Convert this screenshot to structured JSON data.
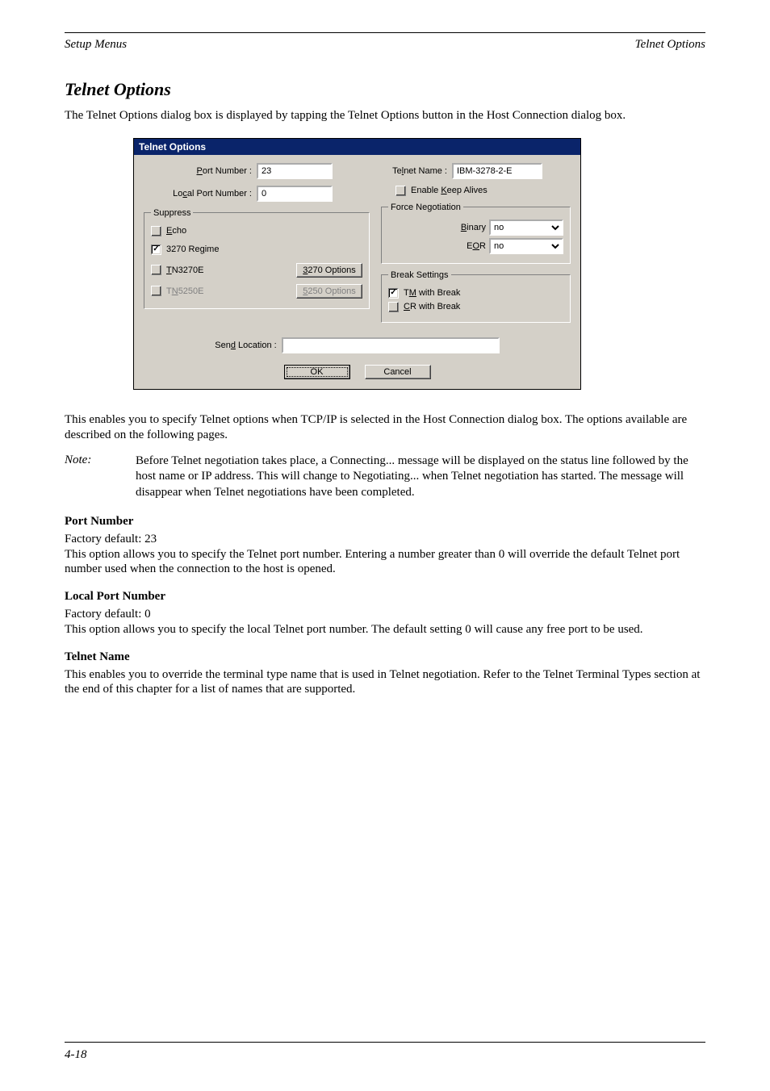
{
  "header": {
    "left": "Setup Menus",
    "right": "Telnet Options"
  },
  "section_title": "Telnet Options",
  "intro": "The Telnet Options dialog box is displayed by tapping the Telnet Options button in the Host Connection dialog box.",
  "dialog": {
    "title": "Telnet Options",
    "port_number": {
      "label_pre": "P",
      "label_post": "ort Number :",
      "value": "23"
    },
    "local_port_number": {
      "label_pre": "Lo",
      "label_u": "c",
      "label_post": "al Port Number :",
      "value": "0"
    },
    "telnet_name": {
      "label_pre": "Te",
      "label_u": "l",
      "label_post": "net Name :",
      "value": "IBM-3278-2-E"
    },
    "enable_keep_alives": {
      "label_pre": "Enable ",
      "label_u": "K",
      "label_post": "eep Alives",
      "checked": false
    },
    "suppress": {
      "legend": "Suppress",
      "echo": {
        "u": "E",
        "post": "cho",
        "checked": false
      },
      "regime3270": {
        "label": "3270 Re",
        "u": "g",
        "post": "ime",
        "checked": true
      },
      "tn3270e": {
        "u": "T",
        "post": "N3270E",
        "checked": false,
        "disabled": false
      },
      "tn5250e": {
        "label_pre": "T",
        "u": "N",
        "post": "5250E",
        "checked": false,
        "disabled": true
      },
      "btn_3270": {
        "u": "3",
        "post": "270 Options"
      },
      "btn_5250": {
        "u": "5",
        "post": "250 Options",
        "disabled": true
      }
    },
    "force_negotiation": {
      "legend": "Force Negotiation",
      "binary": {
        "u": "B",
        "post": "inary",
        "value": "no"
      },
      "eor": {
        "pre": "E",
        "u": "O",
        "post": "R",
        "value": "no"
      }
    },
    "break_settings": {
      "legend": "Break Settings",
      "tm": {
        "pre": "T",
        "u": "M",
        "post": " with Break",
        "checked": true
      },
      "cr": {
        "u": "C",
        "post": "R with Break",
        "checked": false
      }
    },
    "send_location": {
      "label_pre": "Sen",
      "u": "d",
      "label_post": " Location :",
      "value": ""
    },
    "ok": "OK",
    "cancel": "Cancel"
  },
  "post_dialog": "This enables you to specify Telnet options when TCP/IP is selected in the Host Connection dialog box. The options available are described on the following pages.",
  "note": {
    "label": "Note:",
    "text": "Before Telnet negotiation takes place, a Connecting... message will be displayed on the status line followed by the host name or IP address. This will change to Negotiating... when Telnet negotiation has started. The message will disappear when Telnet negotiations have been completed."
  },
  "port_number_section": {
    "title": "Port Number",
    "text": "Factory default: 23\nThis option allows you to specify the Telnet port number. Entering a number greater than 0 will override the default Telnet port number used when the connection to the host is opened."
  },
  "local_port_number_section": {
    "title": "Local Port Number",
    "text": "Factory default: 0\nThis option allows you to specify the local Telnet port number. The default setting 0 will cause any free port to be used."
  },
  "telnet_name_section": {
    "title": "Telnet Name",
    "text": "This enables you to override the terminal type name that is used in Telnet negotiation. Refer to the Telnet Terminal Types section at the end of this chapter for a list of names that are supported."
  },
  "footer": {
    "left": "4-18",
    "right": ""
  }
}
